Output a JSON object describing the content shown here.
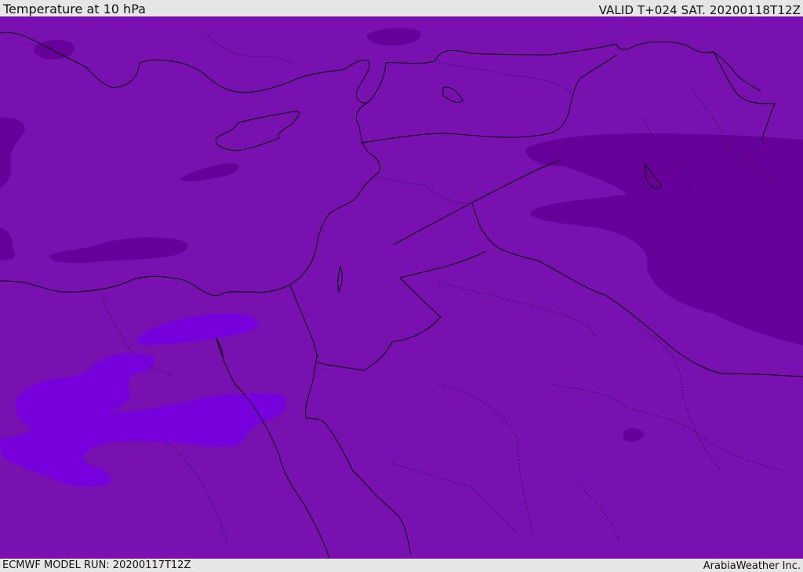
{
  "header": {
    "title": "Temperature at 10 hPa",
    "valid_time": "VALID T+024 SAT. 20200118T12Z"
  },
  "footer": {
    "model_run": "ECMWF MODEL RUN: 20200117T12Z",
    "credit": "ArabiaWeather Inc."
  },
  "map": {
    "variable": "temperature",
    "level": "10 hPa",
    "colors": {
      "base_fill": "#7811b0",
      "cold_fill": "#660099",
      "warm_fill": "#7700dd",
      "coastline": "#000000"
    }
  }
}
